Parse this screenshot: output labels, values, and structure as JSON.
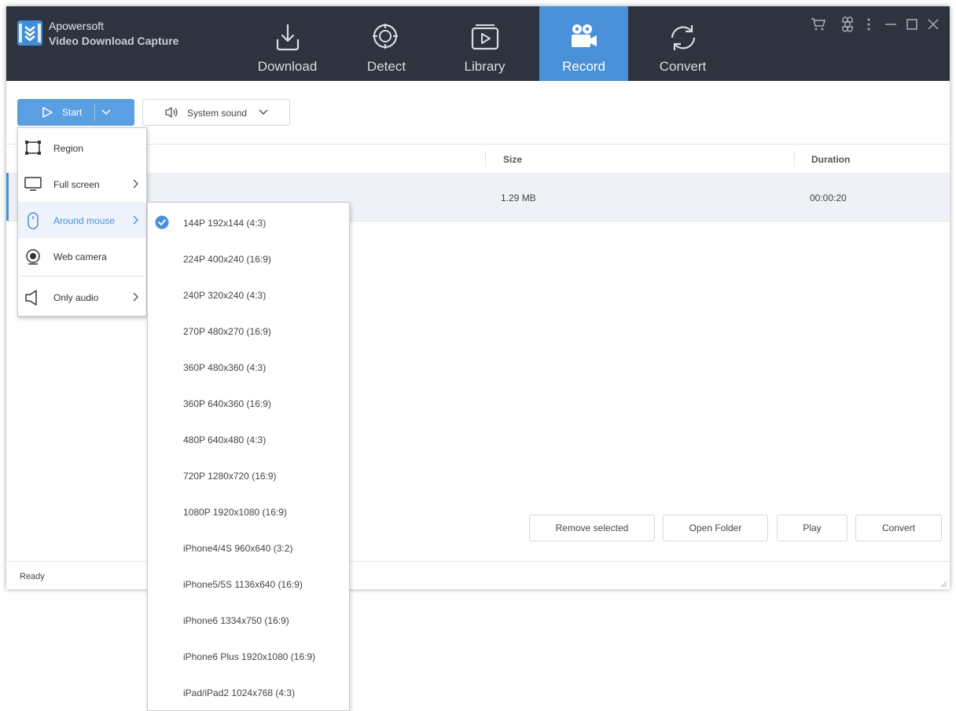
{
  "app": {
    "brand_line1": "Apowersoft",
    "brand_line2": "Video Download Capture"
  },
  "nav": {
    "tabs": [
      {
        "label": "Download",
        "icon": "download-icon"
      },
      {
        "label": "Detect",
        "icon": "detect-icon"
      },
      {
        "label": "Library",
        "icon": "library-icon"
      },
      {
        "label": "Record",
        "icon": "record-icon",
        "active": true
      },
      {
        "label": "Convert",
        "icon": "convert-icon"
      }
    ]
  },
  "window_controls": [
    "cart-icon",
    "command-icon",
    "more-icon",
    "minimize-icon",
    "maximize-icon",
    "close-icon"
  ],
  "toolbar": {
    "start_label": "Start",
    "sound_label": "System sound"
  },
  "table": {
    "columns": [
      "Size",
      "Duration"
    ],
    "rows": [
      {
        "size": "1.29 MB",
        "duration": "00:00:20"
      }
    ]
  },
  "start_menu": {
    "items": [
      {
        "label": "Region",
        "icon": "region-icon"
      },
      {
        "label": "Full screen",
        "icon": "monitor-icon",
        "submenu": true
      },
      {
        "label": "Around mouse",
        "icon": "mouse-icon",
        "submenu": true,
        "highlighted": true
      },
      {
        "label": "Web camera",
        "icon": "webcam-icon"
      },
      {
        "label": "Only audio",
        "icon": "speaker-icon",
        "submenu": true
      }
    ]
  },
  "resolution_menu": {
    "items": [
      {
        "label": "144P 192x144 (4:3)",
        "checked": true
      },
      {
        "label": "224P 400x240 (16:9)"
      },
      {
        "label": "240P 320x240 (4:3)"
      },
      {
        "label": "270P 480x270 (16:9)"
      },
      {
        "label": "360P 480x360 (4:3)"
      },
      {
        "label": "360P 640x360 (16:9)"
      },
      {
        "label": "480P 640x480 (4:3)"
      },
      {
        "label": "720P 1280x720 (16:9)"
      },
      {
        "label": "1080P 1920x1080 (16:9)"
      },
      {
        "label": "iPhone4/4S 960x640 (3:2)"
      },
      {
        "label": "iPhone5/5S 1136x640 (16:9)"
      },
      {
        "label": "iPhone6 1334x750 (16:9)"
      },
      {
        "label": "iPhone6 Plus 1920x1080 (16:9)"
      },
      {
        "label": "iPad/iPad2 1024x768 (4:3)"
      }
    ]
  },
  "actions": {
    "remove_selected": "Remove selected",
    "open_folder": "Open Folder",
    "play": "Play",
    "convert": "Convert"
  },
  "status": {
    "text": "Ready"
  },
  "colors": {
    "titlebar": "#2d3440",
    "accent": "#4a90d9",
    "start_button": "#5b9fe3"
  }
}
